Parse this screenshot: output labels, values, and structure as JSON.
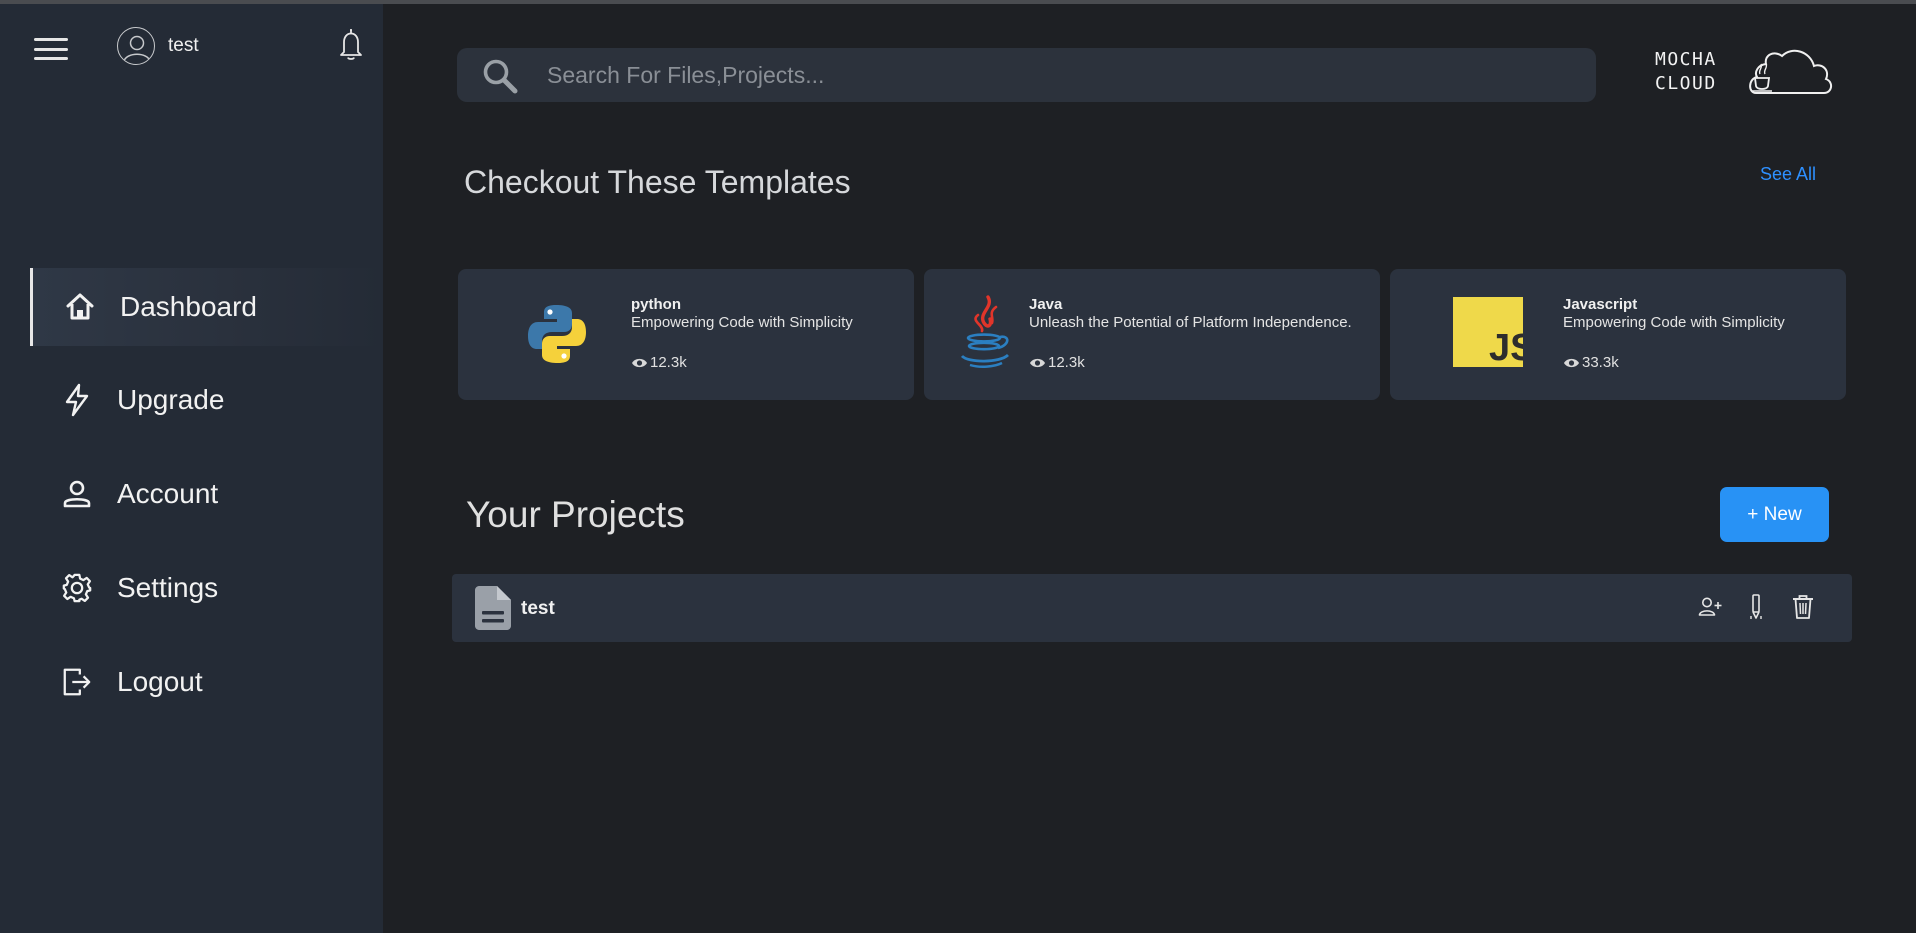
{
  "sidebar": {
    "username": "test",
    "nav": [
      {
        "label": "Dashboard",
        "icon": "home-icon",
        "active": true
      },
      {
        "label": "Upgrade",
        "icon": "lightning-icon"
      },
      {
        "label": "Account",
        "icon": "user-icon"
      },
      {
        "label": "Settings",
        "icon": "gear-icon"
      },
      {
        "label": "Logout",
        "icon": "logout-icon"
      }
    ]
  },
  "search": {
    "placeholder": "Search For Files,Projects..."
  },
  "logo": {
    "line1": "MOCHA",
    "line2": "CLOUD"
  },
  "templates": {
    "title": "Checkout These Templates",
    "see_all": "See All",
    "items": [
      {
        "name": "python",
        "description": "Empowering Code with Simplicity",
        "views": "12.3k",
        "icon": "python-logo-icon"
      },
      {
        "name": "Java",
        "description": "Unleash the Potential of Platform Independence.",
        "views": "12.3k",
        "icon": "java-logo-icon"
      },
      {
        "name": "Javascript",
        "description": "Empowering Code with Simplicity",
        "views": "33.3k",
        "icon": "javascript-logo-icon"
      }
    ]
  },
  "projects": {
    "title": "Your Projects",
    "new_label": "+ New",
    "items": [
      {
        "name": "test"
      }
    ]
  },
  "colors": {
    "accent": "#2892f5",
    "link": "#2e90ff",
    "sidebar_bg": "#242b36",
    "page_bg": "#1e2024",
    "card_bg": "#2b323e"
  }
}
